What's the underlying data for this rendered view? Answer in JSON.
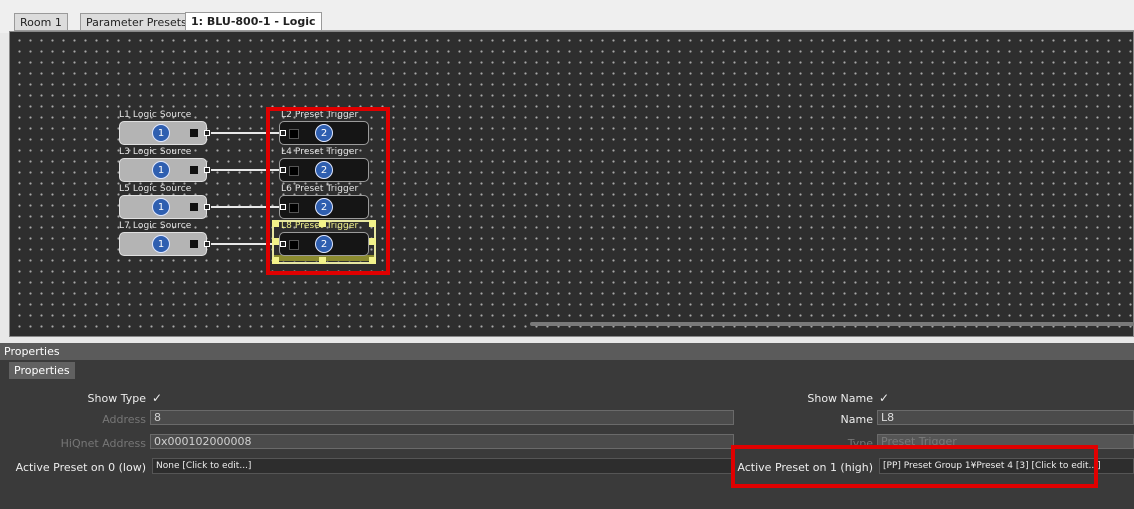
{
  "tabs": [
    {
      "label": "Room 1"
    },
    {
      "label": "Parameter Presets"
    },
    {
      "label": "1: BLU-800-1 - Logic"
    }
  ],
  "canvas": {
    "sources": [
      {
        "label": "L1  Logic Source",
        "number": "1"
      },
      {
        "label": "L3  Logic Source",
        "number": "1"
      },
      {
        "label": "L5  Logic Source",
        "number": "1"
      },
      {
        "label": "L7  Logic Source",
        "number": "1"
      }
    ],
    "triggers": [
      {
        "label": "L2  Preset Trigger",
        "number": "2"
      },
      {
        "label": "L4  Preset Trigger",
        "number": "2"
      },
      {
        "label": "L6  Preset Trigger",
        "number": "2"
      },
      {
        "label": "L8  Preset Trigger",
        "number": "2"
      }
    ]
  },
  "properties": {
    "panel_title": "Properties",
    "tab_label": "Properties",
    "show_type_label": "Show Type",
    "show_type_check": "✓",
    "address_label": "Address",
    "address_value": "8",
    "hiqnet_label": "HiQnet Address",
    "hiqnet_value": "0x000102000008",
    "active_low_label": "Active Preset on 0 (low)",
    "active_low_value": "None [Click to edit...]",
    "show_name_label": "Show Name",
    "show_name_check": "✓",
    "name_label": "Name",
    "name_value": "L8",
    "type_label": "Type",
    "type_value": "Preset Trigger",
    "active_high_label": "Active Preset on 1 (high)",
    "active_high_value": "[PP] Preset Group 1¥Preset 4 [3] [Click to edit...]"
  },
  "colors": {
    "highlight": "#e00000",
    "selection": "#f2f28a",
    "number_badge": "#2f5fb0"
  }
}
